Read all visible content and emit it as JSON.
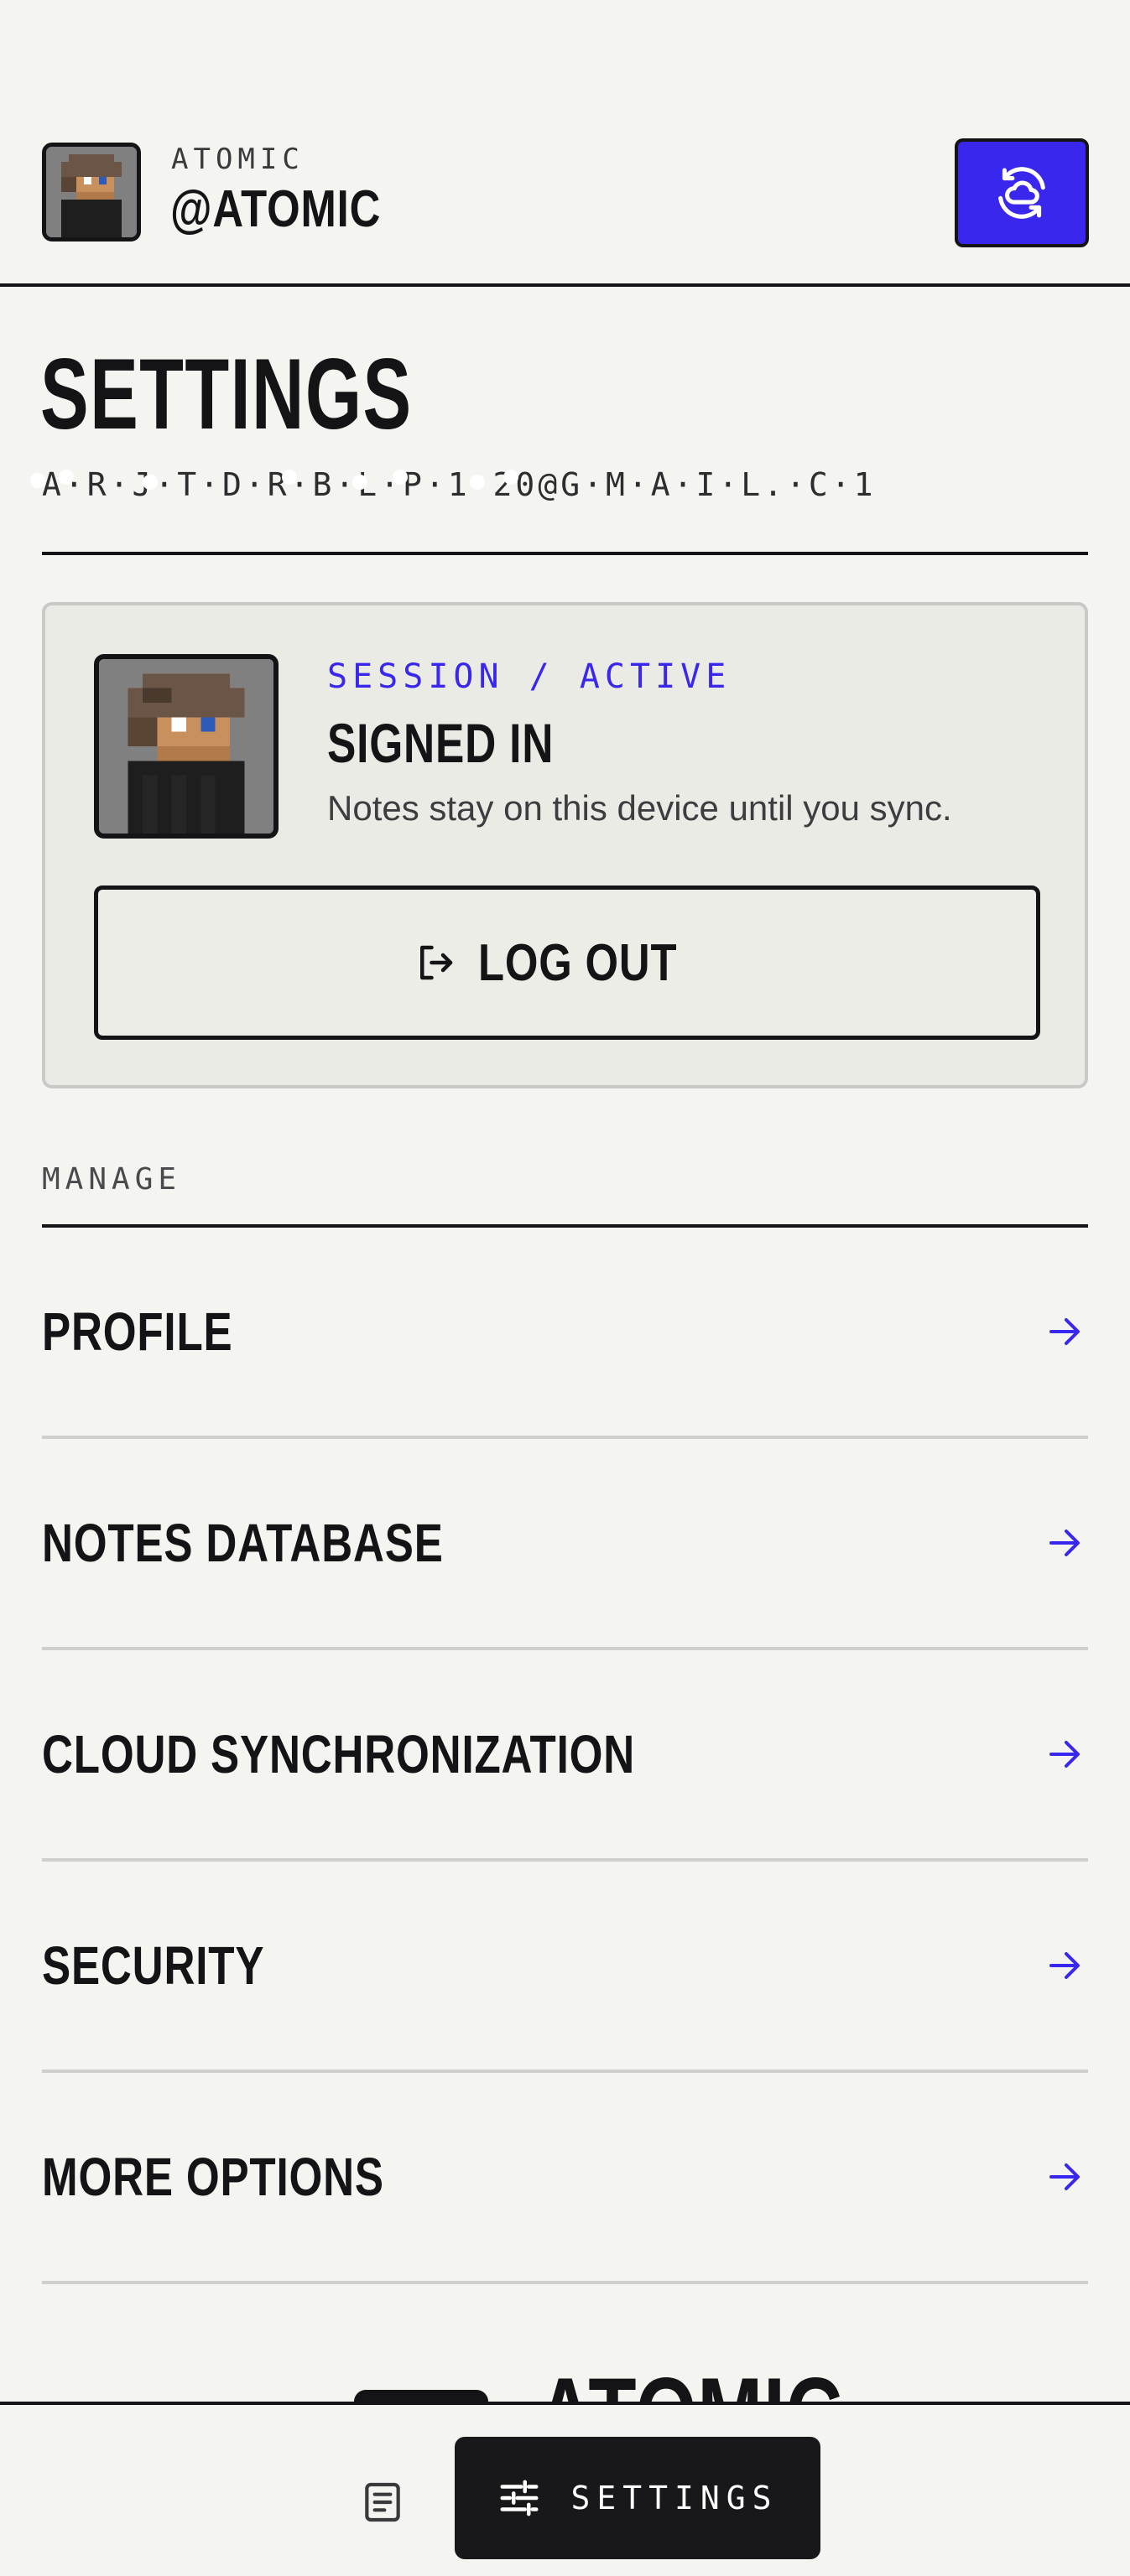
{
  "header": {
    "brand_eyebrow": "ATOMIC",
    "handle": "@ATOMIC",
    "sync_icon": "cloud-sync-icon"
  },
  "page": {
    "title": "SETTINGS",
    "email": "A·R·J·T·D·R·B·L·P·1·20@G·M·A·I·L.·C·1"
  },
  "session": {
    "status": "SESSION / ACTIVE",
    "heading": "SIGNED IN",
    "description": "Notes stay on this device until you sync.",
    "logout_label": "LOG OUT",
    "logout_icon": "logout-icon"
  },
  "manage": {
    "label": "MANAGE",
    "items": [
      {
        "label": "PROFILE"
      },
      {
        "label": "NOTES DATABASE"
      },
      {
        "label": "CLOUD SYNCHRONIZATION"
      },
      {
        "label": "SECURITY"
      },
      {
        "label": "MORE OPTIONS"
      }
    ],
    "arrow_icon": "arrow-right-icon"
  },
  "footer": {
    "logo_text": "ATOMIC"
  },
  "bottom_nav": {
    "notes_icon": "notes-icon",
    "settings_label": "SETTINGS",
    "settings_icon": "sliders-icon"
  },
  "colors": {
    "accent": "#3a27ee",
    "ink": "#141416",
    "background": "#f4f4f1",
    "card": "#ebebe6"
  }
}
